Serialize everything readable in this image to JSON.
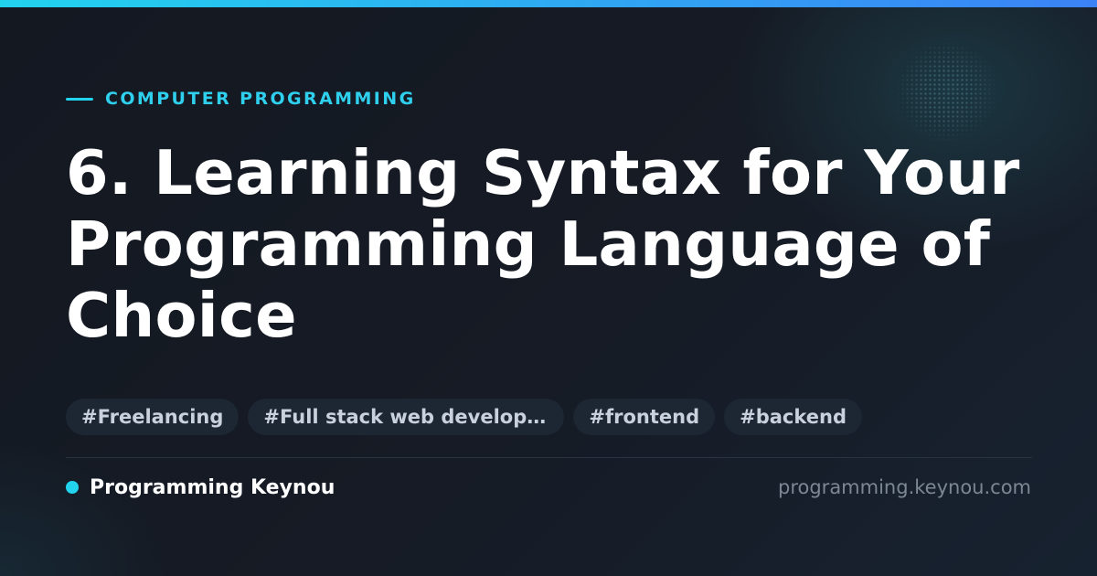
{
  "colors": {
    "accent": "#22d3ee",
    "accent_end": "#3b82f6",
    "title": "#ffffff",
    "tag_bg": "#1d2633",
    "tag_text": "#c9d1dc",
    "muted": "#7d8794"
  },
  "category": {
    "label": "COMPUTER PROGRAMMING"
  },
  "title": "6. Learning Syntax for Your Programming Language of Choice",
  "tags": [
    "#Freelancing",
    "#Full stack web developm…",
    "#frontend",
    "#backend"
  ],
  "footer": {
    "brand": "Programming Keynou",
    "domain": "programming.keynou.com"
  }
}
